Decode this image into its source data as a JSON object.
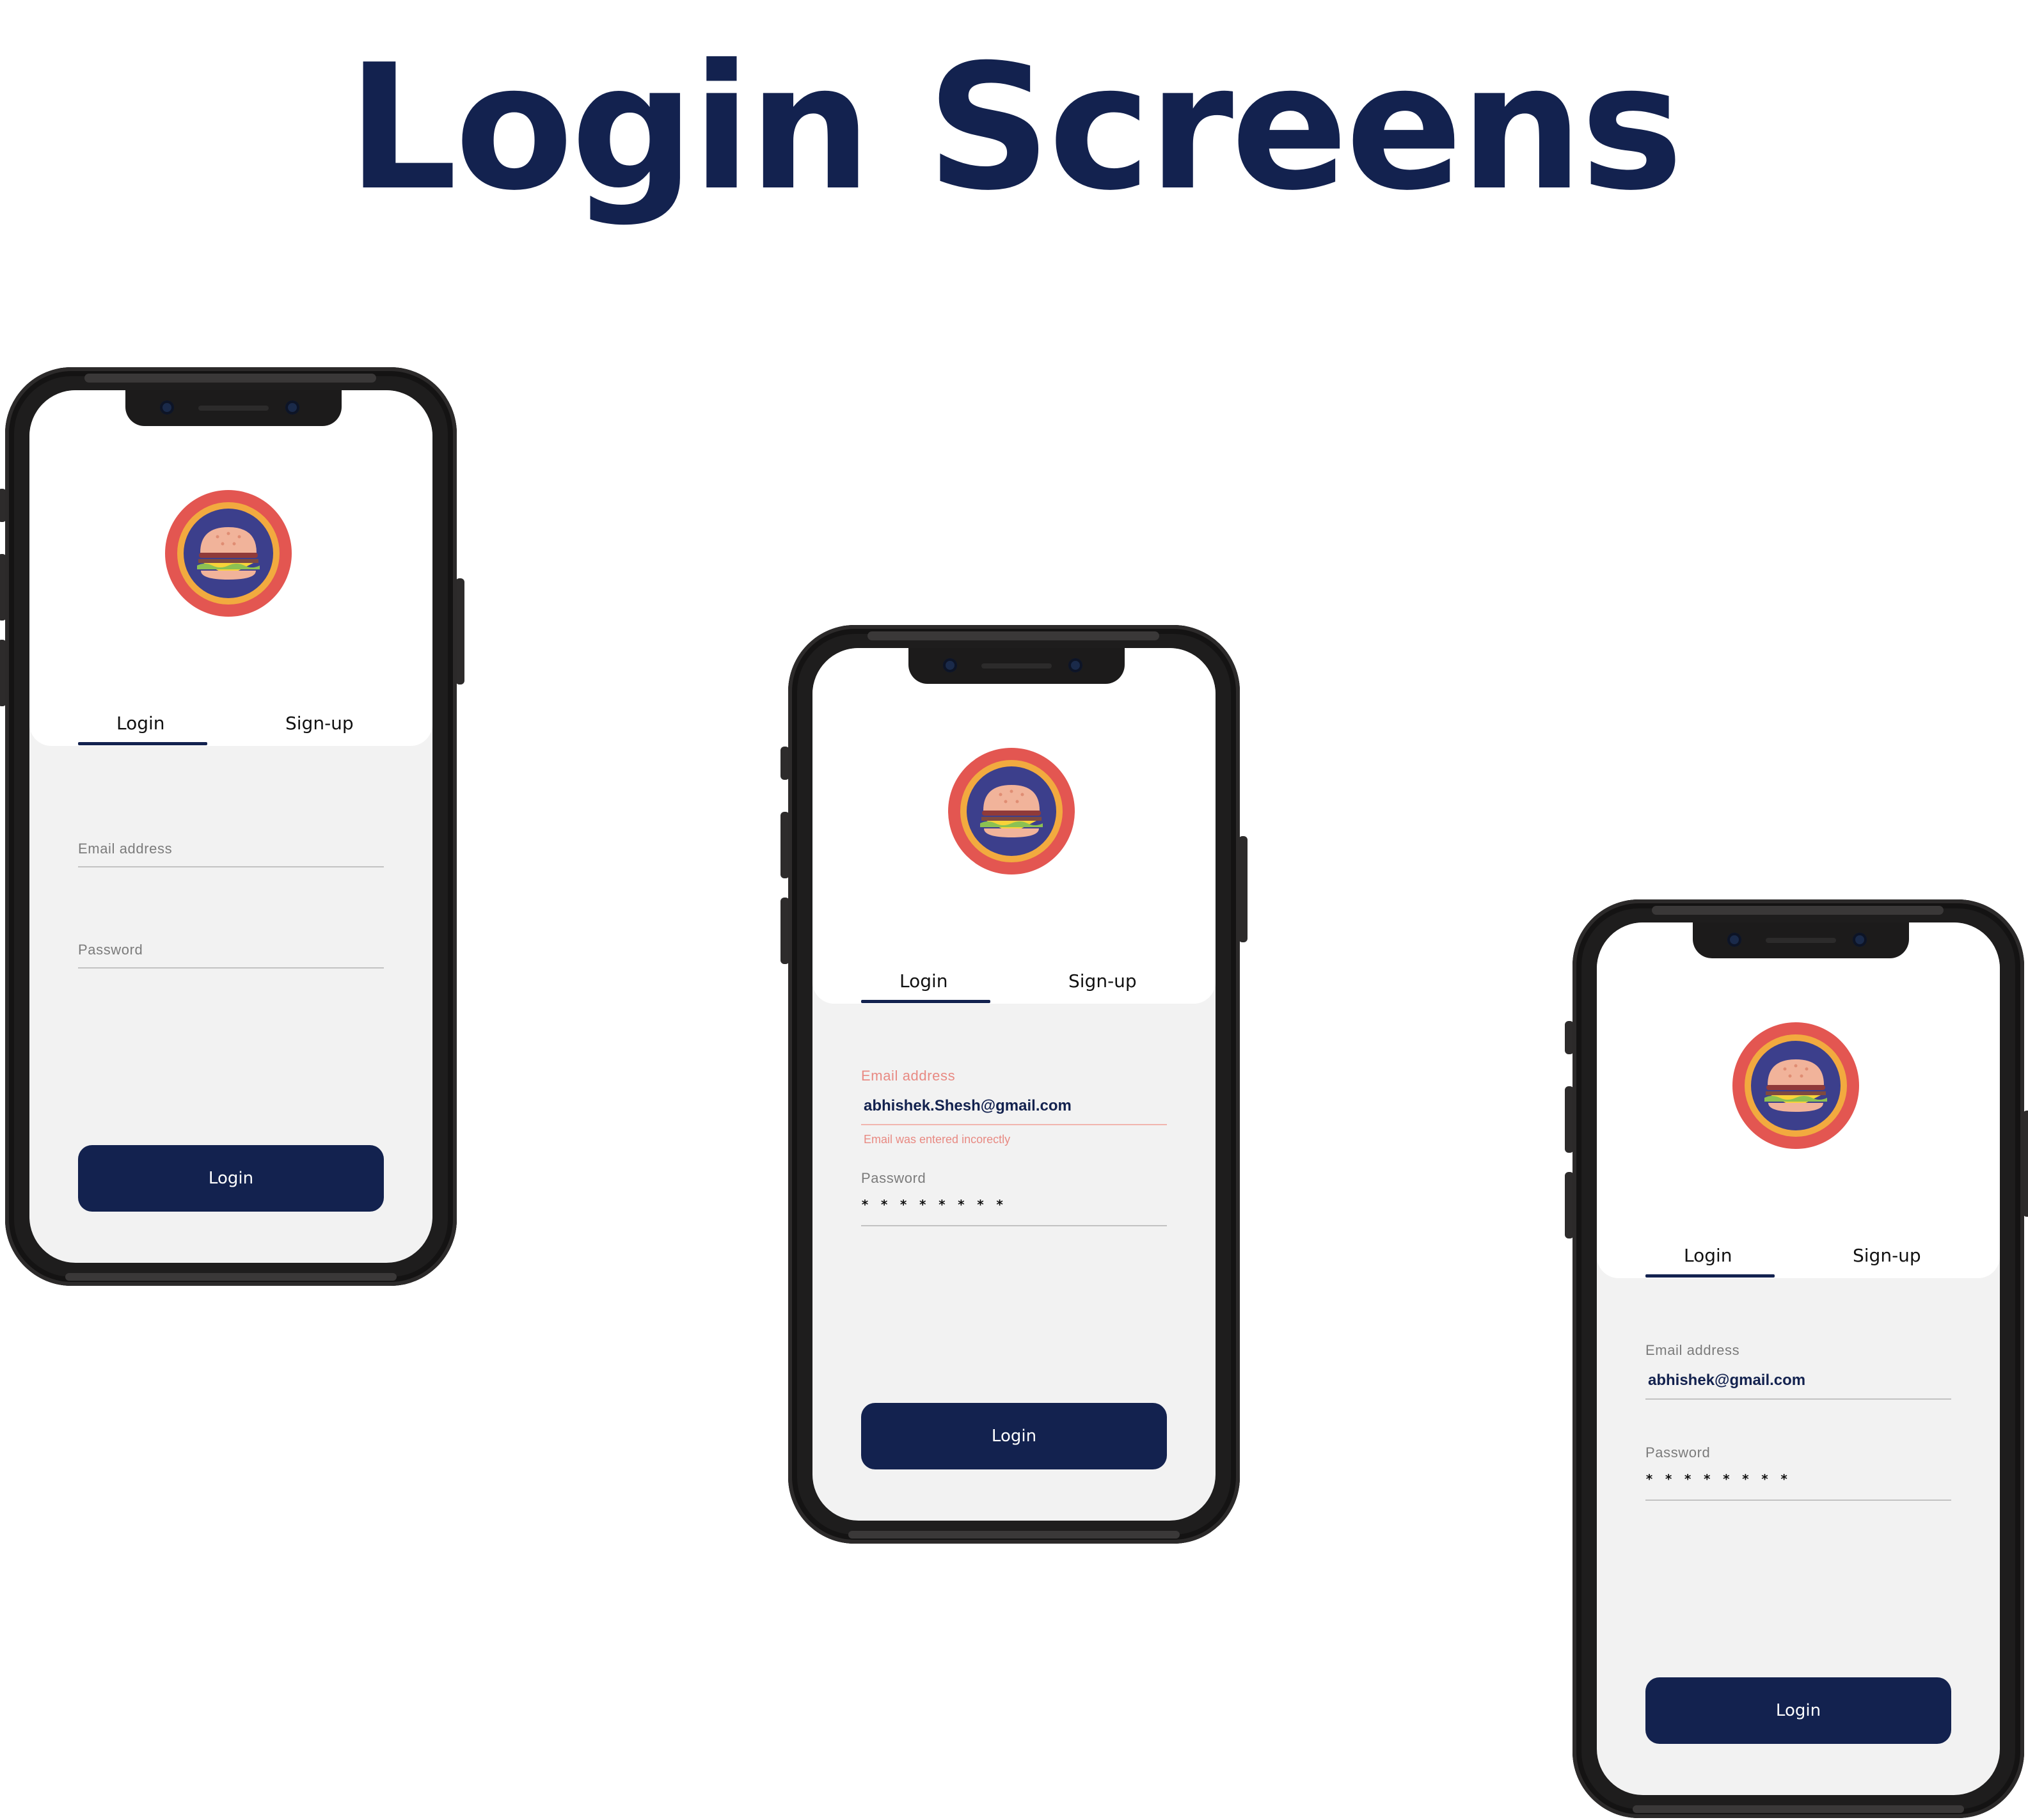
{
  "title": "Login Screens",
  "colors": {
    "primary": "#13224f",
    "error": "#e88a83",
    "logo_outer": "#e35651",
    "logo_ring": "#f2aa3f",
    "logo_inner": "#3c3f8c"
  },
  "phones": [
    {
      "tabs": {
        "login": "Login",
        "signup": "Sign-up"
      },
      "email": {
        "label": "Email address",
        "value": ""
      },
      "password": {
        "label": "Password",
        "value": ""
      },
      "button": "Login"
    },
    {
      "tabs": {
        "login": "Login",
        "signup": "Sign-up"
      },
      "email": {
        "label": "Email address",
        "value": "abhishek.Shesh@gmail.com",
        "error": "Email was entered incorectly"
      },
      "password": {
        "label": "Password",
        "value": "* * * * * * * *"
      },
      "button": "Login"
    },
    {
      "tabs": {
        "login": "Login",
        "signup": "Sign-up"
      },
      "email": {
        "label": "Email address",
        "value": "abhishek@gmail.com"
      },
      "password": {
        "label": "Password",
        "value": "* * * * * * * *"
      },
      "button": "Login"
    }
  ]
}
